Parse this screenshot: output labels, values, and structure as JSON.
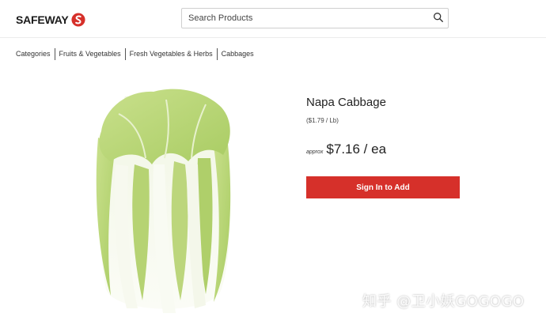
{
  "brand": {
    "logo_text": "SAFEWAY",
    "logo_icon": "safeway-s-icon",
    "brand_color": "#d6302a"
  },
  "search": {
    "placeholder": "Search Products",
    "icon": "search-icon"
  },
  "breadcrumb": {
    "items": [
      "Categories",
      "Fruits & Vegetables",
      "Fresh Vegetables & Herbs",
      "Cabbages"
    ]
  },
  "product": {
    "title": "Napa Cabbage",
    "unit_price": "($1.79 / Lb)",
    "approx_label": "approx",
    "price": "$7.16 / ea",
    "cta_label": "Sign In to Add",
    "cta_color": "#d6302a"
  },
  "watermark": {
    "text": "知乎 @卫小妖GOGOGO"
  }
}
